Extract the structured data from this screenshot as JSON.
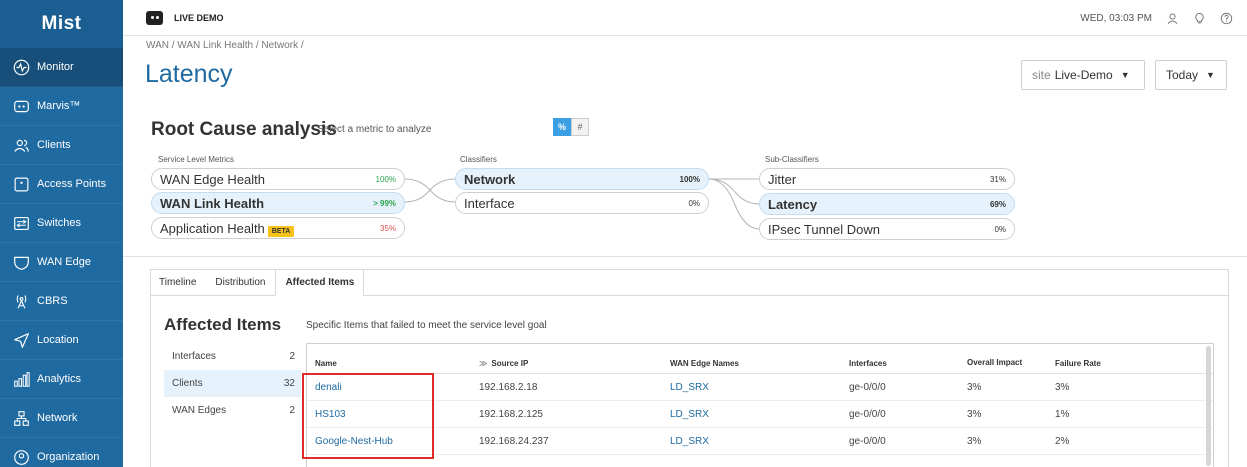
{
  "sidebar": {
    "logo": "Mist",
    "items": [
      {
        "label": "Monitor",
        "icon": "activity-icon",
        "active": true
      },
      {
        "label": "Marvis™",
        "icon": "marvis-icon"
      },
      {
        "label": "Clients",
        "icon": "users-icon"
      },
      {
        "label": "Access Points",
        "icon": "access-point-icon"
      },
      {
        "label": "Switches",
        "icon": "switch-icon"
      },
      {
        "label": "WAN Edge",
        "icon": "shield-icon"
      },
      {
        "label": "CBRS",
        "icon": "antenna-icon"
      },
      {
        "label": "Location",
        "icon": "location-arrow-icon"
      },
      {
        "label": "Analytics",
        "icon": "bar-chart-icon"
      },
      {
        "label": "Network",
        "icon": "network-icon"
      },
      {
        "label": "Organization",
        "icon": "org-icon"
      }
    ]
  },
  "topbar": {
    "demo_label": "LIVE DEMO",
    "datetime": "WED, 03:03 PM"
  },
  "header": {
    "breadcrumb": "WAN / WAN Link Health / Network /",
    "title": "Latency",
    "site_prefix": "site",
    "site_value": "Live-Demo",
    "range_value": "Today"
  },
  "rca": {
    "title": "Root Cause analysis",
    "subtitle": "Select a metric to analyze",
    "toggle_on": "%",
    "toggle_off": "#",
    "col1_label": "Service Level Metrics",
    "col2_label": "Classifiers",
    "col3_label": "Sub-Classifiers",
    "metrics": [
      {
        "label": "WAN Edge Health",
        "pct": "100%"
      },
      {
        "label": "WAN Link Health",
        "pct": "> 99%"
      },
      {
        "label": "Application Health",
        "pct": "35%",
        "badge": "BETA"
      }
    ],
    "classifiers": [
      {
        "label": "Network",
        "pct": "100%"
      },
      {
        "label": "Interface",
        "pct": "0%"
      }
    ],
    "subclassifiers": [
      {
        "label": "Jitter",
        "pct": "31%"
      },
      {
        "label": "Latency",
        "pct": "69%"
      },
      {
        "label": "IPsec Tunnel Down",
        "pct": "0%"
      }
    ]
  },
  "tabs": [
    "Timeline",
    "Distribution",
    "Affected Items"
  ],
  "affected": {
    "title": "Affected Items",
    "subtitle": "Specific Items that failed to meet the service level goal",
    "categories": [
      {
        "label": "Interfaces",
        "count": "2"
      },
      {
        "label": "Clients",
        "count": "32"
      },
      {
        "label": "WAN Edges",
        "count": "2"
      }
    ],
    "columns": [
      "Name",
      "Source IP",
      "WAN Edge Names",
      "Interfaces",
      "Overall Impact",
      "Failure Rate"
    ],
    "rows": [
      {
        "name": "denali",
        "ip": "192.168.2.18",
        "edge": "LD_SRX",
        "iface": "ge-0/0/0",
        "impact": "3%",
        "rate": "3%"
      },
      {
        "name": "HS103",
        "ip": "192.168.2.125",
        "edge": "LD_SRX",
        "iface": "ge-0/0/0",
        "impact": "3%",
        "rate": "1%"
      },
      {
        "name": "Google-Nest-Hub",
        "ip": "192.168.24.237",
        "edge": "LD_SRX",
        "iface": "ge-0/0/0",
        "impact": "3%",
        "rate": "2%"
      }
    ]
  },
  "colors": {
    "sidebar": "#1e6aa1",
    "accent": "#1e6aa1",
    "selected": "#e6f2fb",
    "highlight": "#e02b2b"
  }
}
